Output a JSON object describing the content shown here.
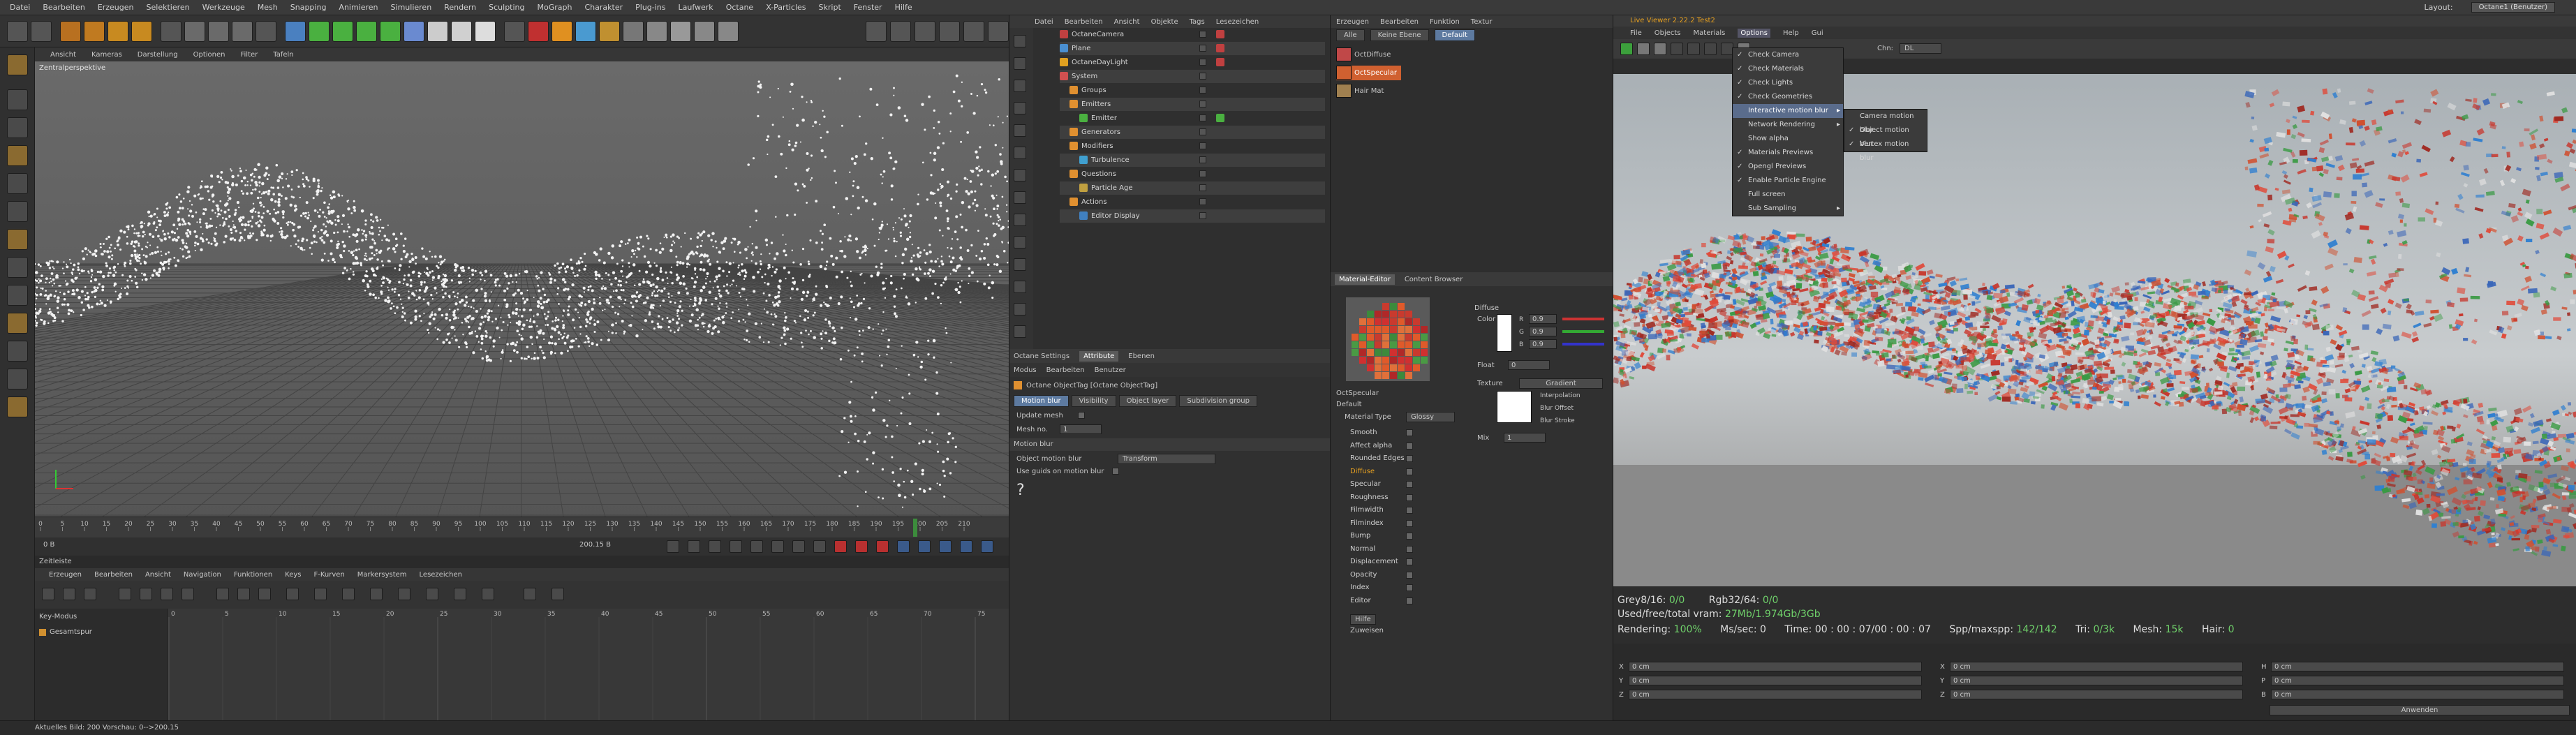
{
  "menubar": [
    "Datei",
    "Bearbeiten",
    "Erzeugen",
    "Selektieren",
    "Werkzeuge",
    "Mesh",
    "Snapping",
    "Animieren",
    "Simulieren",
    "Rendern",
    "Sculpting",
    "MoGraph",
    "Charakter",
    "Plug-ins",
    "Laufwerk",
    "Octane",
    "X-Particles",
    "Skript",
    "Fenster",
    "Hilfe"
  ],
  "layout": {
    "label": "Layout:",
    "value": "Octane1 (Benutzer)"
  },
  "viewport": {
    "menu": [
      "Ansicht",
      "Kameras",
      "Darstellung",
      "Optionen",
      "Filter",
      "Tafeln"
    ],
    "label": "Zentralperspektive",
    "ticks": [
      "0",
      "5",
      "10",
      "15",
      "20",
      "25",
      "30",
      "35",
      "40",
      "45",
      "50",
      "55",
      "60",
      "65",
      "70",
      "75",
      "80",
      "85",
      "90",
      "95",
      "100",
      "105",
      "110",
      "115",
      "120",
      "125",
      "130",
      "135",
      "140",
      "145",
      "150",
      "155",
      "160",
      "165",
      "170",
      "175",
      "180",
      "185",
      "190",
      "195",
      "200",
      "205",
      "210"
    ],
    "frame_start": "0 B",
    "frame_end": "200 B",
    "frame_end2": "200.15 B",
    "current": "200 B"
  },
  "timeline": {
    "title": "Zeitleiste",
    "menu": [
      "Erzeugen",
      "Bearbeiten",
      "Ansicht",
      "Navigation",
      "Funktionen",
      "Keys",
      "F-Kurven",
      "Markersystem",
      "Lesezeichen"
    ],
    "keymodus": "Key-Modus",
    "track": "Gesamtspur",
    "ticks": [
      "0",
      "5",
      "10",
      "15",
      "20",
      "25",
      "30",
      "35",
      "40",
      "45",
      "50",
      "55",
      "60",
      "65",
      "70",
      "75"
    ]
  },
  "status": "Aktuelles Bild: 200   Vorschau: 0-->200.15",
  "object_manager": {
    "menu": [
      "Datei",
      "Bearbeiten",
      "Ansicht",
      "Objekte",
      "Tags",
      "Lesezeichen"
    ],
    "rows": [
      {
        "name": "OctaneCamera",
        "color": "#c04040"
      },
      {
        "name": "Plane",
        "color": "#4a8fd0"
      },
      {
        "name": "OctaneDayLight",
        "color": "#e0a020"
      },
      {
        "name": "System",
        "color": "#d05050"
      },
      {
        "name": "Groups",
        "color": "#e09030"
      },
      {
        "name": "Emitters",
        "color": "#e09030"
      },
      {
        "name": "Emitter",
        "color": "#4ab040"
      },
      {
        "name": "Generators",
        "color": "#e09030"
      },
      {
        "name": "Modifiers",
        "color": "#e09030"
      },
      {
        "name": "Turbulence",
        "color": "#40a0d0"
      },
      {
        "name": "Questions",
        "color": "#e09030"
      },
      {
        "name": "Particle Age",
        "color": "#c0a040"
      },
      {
        "name": "Actions",
        "color": "#e09030"
      },
      {
        "name": "Editor Display",
        "color": "#4080c0"
      }
    ]
  },
  "attribute_manager": {
    "tabs": [
      "Octane Settings",
      "Attribute",
      "Ebenen"
    ],
    "menu": [
      "Modus",
      "Bearbeiten",
      "Benutzer"
    ],
    "title": "Octane ObjectTag [Octane ObjectTag]",
    "buttons": [
      "Motion blur",
      "Visibility",
      "Object layer",
      "Subdivision group"
    ],
    "update_mesh": "Update mesh",
    "mesh_no": "Mesh no.",
    "mesh_no_value": "1",
    "section": "Motion blur",
    "object_motion_blur": "Object motion blur",
    "object_motion_blur_value": "Transform",
    "use_guids": "Use guids on motion blur",
    "help": "?"
  },
  "material_manager": {
    "menu": [
      "Erzeugen",
      "Bearbeiten",
      "Funktion",
      "Textur"
    ],
    "filters": [
      "Alle",
      "Keine Ebene",
      "Default"
    ],
    "materials": [
      {
        "name": "OctDiffuse",
        "color": "#c04848"
      },
      {
        "name": "OctSpecular",
        "color": "#d06030"
      },
      {
        "name": "Hair Mat",
        "color": "#a08050"
      }
    ]
  },
  "material_editor": {
    "tabs": [
      "Material-Editor",
      "Content Browser"
    ],
    "material": "OctSpecular",
    "default": "Default",
    "material_type_label": "Material Type",
    "material_type": "Glossy",
    "channels": [
      "Smooth",
      "Affect alpha",
      "Rounded Edges",
      "Diffuse",
      "Specular",
      "Roughness",
      "Filmwidth",
      "Filmindex",
      "Bump",
      "Normal",
      "Displacement",
      "Opacity",
      "Index",
      "Editor"
    ],
    "help": "Hilfe",
    "assign": "Zuweisen",
    "diffuse": {
      "section": "Diffuse",
      "color": "Color",
      "r": "0.9",
      "g": "0.9",
      "b": "0.9",
      "float": "Float",
      "float_value": "0",
      "texture": "Texture",
      "gradient": "Gradient",
      "interpolation": "Interpolation",
      "blur_offset": "Blur Offset",
      "blur_stroke": "Blur Stroke",
      "mix": "Mix",
      "mix_value": "1"
    }
  },
  "live_viewer": {
    "title": "Live Viewer 2.22.2 Test2",
    "menu": [
      "File",
      "Objects",
      "Materials",
      "Options",
      "Help",
      "Gui"
    ],
    "chn_label": "Chn:",
    "chn_value": "DL",
    "options_menu": [
      {
        "label": "Check Camera",
        "checked": true
      },
      {
        "label": "Check Materials",
        "checked": true
      },
      {
        "label": "Check Lights",
        "checked": true
      },
      {
        "label": "Check Geometries",
        "checked": true
      },
      {
        "label": "Interactive motion blur",
        "checked": false,
        "sub": true,
        "hl": true
      },
      {
        "label": "Network Rendering",
        "checked": false,
        "sub": true
      },
      {
        "label": "Show alpha",
        "checked": false
      },
      {
        "label": "Materials Previews",
        "checked": true
      },
      {
        "label": "Opengl Previews",
        "checked": true
      },
      {
        "label": "Enable Particle Engine",
        "checked": true
      },
      {
        "label": "Full screen",
        "checked": false
      },
      {
        "label": "Sub Sampling",
        "checked": false,
        "sub": true
      }
    ],
    "submenu": [
      {
        "label": "Camera motion blur",
        "checked": false
      },
      {
        "label": "Object motion blur",
        "checked": true
      },
      {
        "label": "Vertex motion blur",
        "checked": true
      }
    ],
    "stats1": {
      "grey_label": "Grey8/16:",
      "grey": "0/0",
      "rgb_label": "Rgb32/64:",
      "rgb": "0/0"
    },
    "stats2": {
      "label": "Used/free/total vram:",
      "value": "27Mb/1.974Gb/3Gb"
    },
    "stats3": {
      "rendering_label": "Rendering:",
      "rendering": "100%",
      "ms_label": "Ms/sec:",
      "ms": "0",
      "time_label": "Time:",
      "time": "00 : 00 : 07/00 : 00 : 07",
      "spp_label": "Spp/maxspp:",
      "spp": "142/142",
      "tri_label": "Tri:",
      "tri": "0/3k",
      "mesh_label": "Mesh:",
      "mesh": "15k",
      "hair_label": "Hair:",
      "hair": "0"
    },
    "coords": {
      "x": "X",
      "y": "Y",
      "z": "Z",
      "h": "H",
      "p": "P",
      "b": "B",
      "zero": "0 cm",
      "apply": "Anwenden"
    }
  }
}
